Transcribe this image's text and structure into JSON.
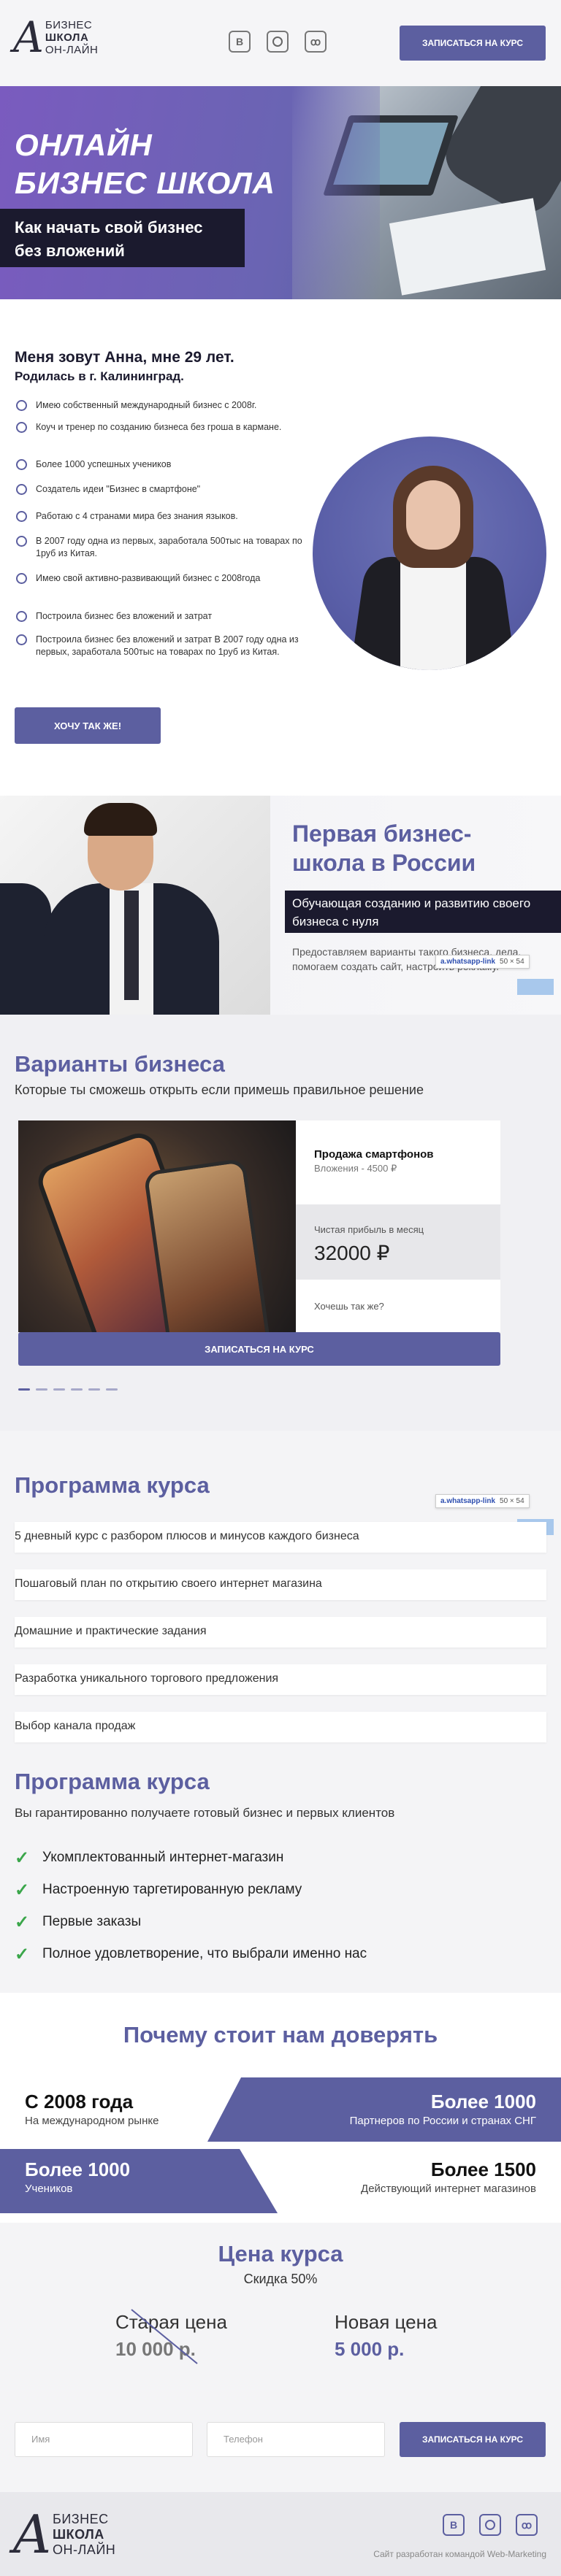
{
  "brand": {
    "logo_mark": "A",
    "logo_lines": [
      "БИЗНЕС",
      "ШКОЛА",
      "ОН-ЛАЙН"
    ],
    "cta": "ЗАПИСАТЬСЯ НА КУРС",
    "social_icons": [
      "vk-icon",
      "instagram-icon",
      "ok-icon"
    ]
  },
  "hero": {
    "title_line1": "ОНЛАЙН",
    "title_line2": "БИЗНЕС ШКОЛА",
    "subtitle": "Как начать свой бизнес без вложений"
  },
  "about": {
    "heading_line1": "Меня зовут Анна, мне 29 лет.",
    "heading_line2": "Родилась в г. Калининград.",
    "bullets": [
      "Имею собственный международный бизнес с 2008г.",
      "Коуч и тренер по созданию бизнеса без гроша в кармане.",
      "Более 1000 успешных учеников",
      "Создатель идеи \"Бизнес в смартфоне\"",
      "Работаю с 4 странами мира без знания языков.",
      "В 2007 году одна из первых, заработала 500тыс на товарах по 1руб из Китая.",
      "Имею свой активно-развивающий бизнес с 2008года",
      "Построила бизнес без вложений и затрат",
      "Построила бизнес без вложений и затрат В 2007 году одна из первых, заработала 500тыс на товарах по 1руб из Китая."
    ],
    "button": "ХОЧУ ТАК ЖЕ!"
  },
  "school": {
    "title_line1": "Первая бизнес-",
    "title_line2": "школа в России",
    "band": "Обучающая созданию и развитию своего бизнеса с нуля",
    "text": "Предоставляем варианты такого бизнеса, дела, помогаем создать сайт, настроить рекламу."
  },
  "overlay": {
    "label": "a.whatsapp-link",
    "size": "50 × 54"
  },
  "variants": {
    "title": "Варианты бизнеса",
    "subtitle": "Которые ты сможешь открыть если примешь правильное решение",
    "card_title": "Продажа смартфонов",
    "card_investment": "Вложения - 4500 ₽",
    "profit_label": "Чистая прибыль в месяц",
    "profit_value": "32000 ₽",
    "question": "Хочешь так же?",
    "button": "ЗАПИСАТЬСЯ НА КУРС",
    "slides_count": 6,
    "active_slide": 1
  },
  "program": {
    "title": "Программа курса",
    "items": [
      "5 дневный курс с разбором плюсов и минусов каждого бизнеса",
      "Пошаговый план по открытию своего интернет магазина",
      "Домашние и практические задания",
      "Разработка уникального торгового предложения",
      "Выбор канала продаж"
    ]
  },
  "results": {
    "title": "Программа курса",
    "subtitle": "Вы гарантированно получаете готовый бизнес и первых клиентов",
    "items": [
      "Укомплектованный интернет-магазин",
      "Настроенную таргетированную рекламу",
      "Первые заказы",
      "Полное удовлетворение, что выбрали именно нас"
    ]
  },
  "trust": {
    "title": "Почему стоит нам доверять",
    "facts": [
      {
        "big": "С 2008 года",
        "small": "На международном рынке"
      },
      {
        "big": "Более 1000",
        "small": "Партнеров по России и странах СНГ"
      },
      {
        "big": "Более 1000",
        "small": "Учеников"
      },
      {
        "big": "Более 1500",
        "small": "Действующий интернет магазинов"
      }
    ]
  },
  "price": {
    "title": "Цена курса",
    "discount": "Скидка 50%",
    "old_label": "Старая цена",
    "old_value": "10 000 р.",
    "new_label": "Новая цена",
    "new_value": "5 000 р."
  },
  "form": {
    "name_placeholder": "Имя",
    "phone_placeholder": "Телефон",
    "button": "ЗАПИСАТЬСЯ НА КУРС"
  },
  "footer": {
    "credit": "Сайт разработан командой Web-Marketing"
  },
  "colors": {
    "accent": "#5c5fa0",
    "dark": "#1b1a2e",
    "check": "#3aa64a"
  }
}
